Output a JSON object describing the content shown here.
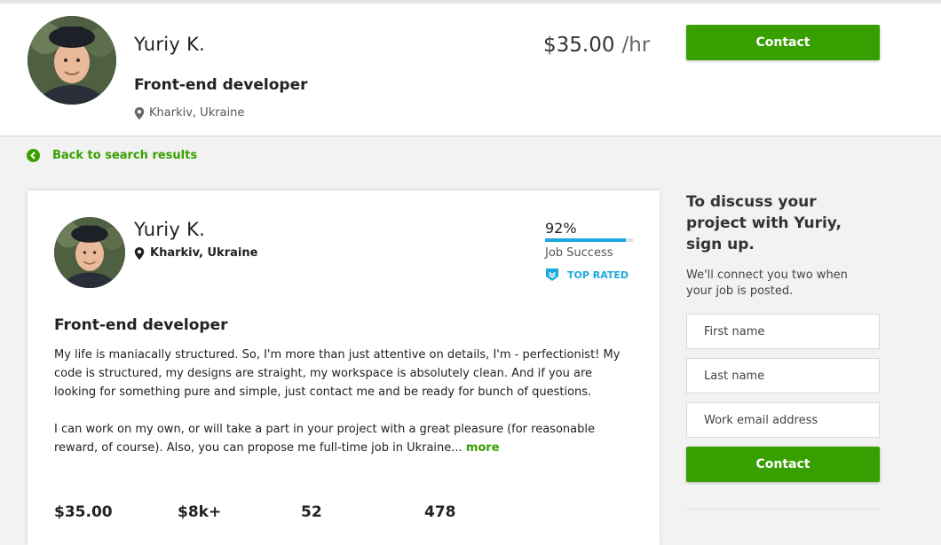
{
  "profile": {
    "name": "Yuriy K.",
    "title": "Front-end developer",
    "location": "Kharkiv, Ukraine",
    "rate": "$35.00",
    "rate_unit": "/hr"
  },
  "header": {
    "contact_label": "Contact"
  },
  "nav": {
    "back_label": "Back to search results"
  },
  "card": {
    "job_success_pct": "92%",
    "job_success_value": 0.92,
    "job_success_label": "Job Success",
    "top_rated_label": "TOP RATED",
    "bio_paragraph_1": "My life is maniacally structured. So, I'm more than just attentive on details, I'm - perfectionist! My code is structured, my designs are straight, my workspace is absolutely clean. And if you are looking for something pure and simple, just contact me and be ready for bunch of questions.",
    "bio_paragraph_2": "I can work on my own, or will take a part in your project with a great pleasure (for reasonable reward, of course). Also, you can propose me full-time job in Ukraine...",
    "more_label": "more",
    "stats": [
      "$35.00",
      "$8k+",
      "52",
      "478"
    ]
  },
  "sidebar": {
    "heading": "To discuss your project with Yuriy, sign up.",
    "subtext": "We'll connect you two when your job is posted.",
    "first_name_placeholder": "First name",
    "last_name_placeholder": "Last name",
    "email_placeholder": "Work email address",
    "contact_label": "Contact"
  },
  "colors": {
    "accent_green": "#37a000",
    "accent_blue": "#1ca8dd"
  },
  "icons": [
    "map-pin-icon",
    "back-chevron-icon",
    "top-rated-badge-icon"
  ]
}
